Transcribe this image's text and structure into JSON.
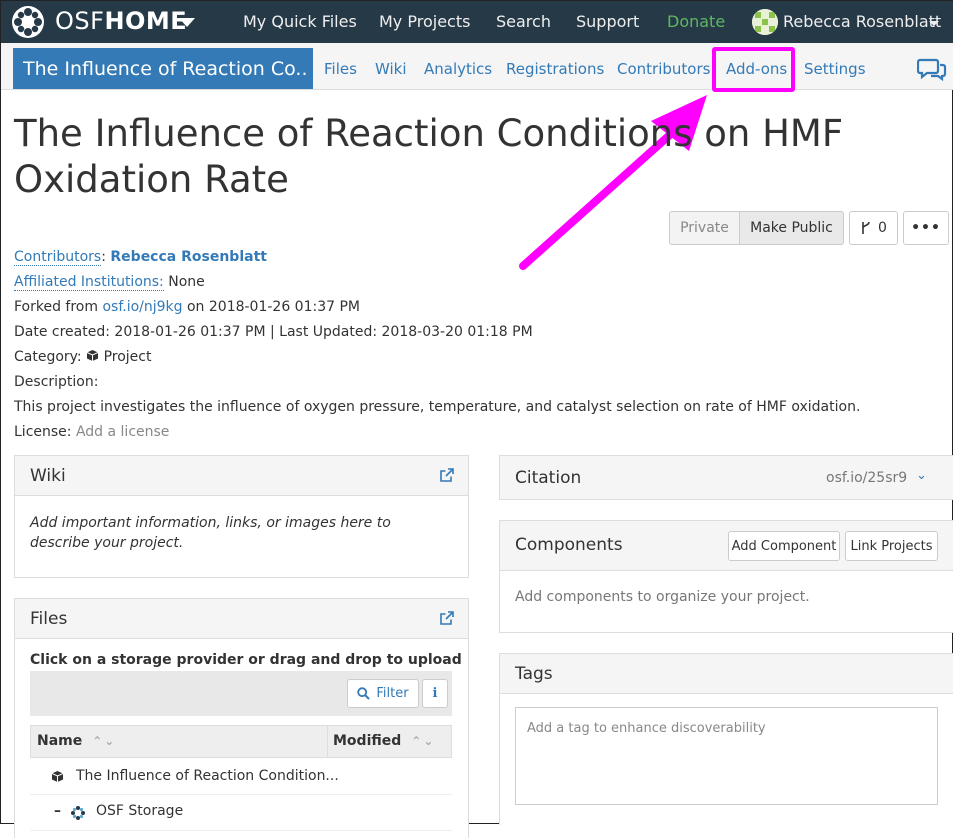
{
  "topnav": {
    "brand_light": "OSF",
    "brand_bold": "HOME",
    "items": [
      "My Quick Files",
      "My Projects",
      "Search",
      "Support",
      "Donate"
    ],
    "user_name": "Rebecca Rosenblatt"
  },
  "projnav": {
    "project_title": "The Influence of Reaction Co...",
    "tabs": [
      "Files",
      "Wiki",
      "Analytics",
      "Registrations",
      "Contributors",
      "Add-ons",
      "Settings"
    ]
  },
  "page": {
    "title": "The Influence of Reaction Conditions on HMF Oxidation Rate",
    "private_label": "Private",
    "make_public_label": "Make Public",
    "fork_count": "0",
    "more_label": "•••"
  },
  "meta": {
    "contributors_label": "Contributors",
    "contributors_value": "Rebecca Rosenblatt",
    "affiliated_label": "Affiliated Institutions:",
    "affiliated_value": "None",
    "forked_prefix": "Forked from",
    "forked_link": "osf.io/nj9kg",
    "forked_suffix": "on 2018-01-26 01:37 PM",
    "dates": "Date created: 2018-01-26 01:37 PM | Last Updated: 2018-03-20 01:18 PM",
    "category_label": "Category:",
    "category_value": "Project",
    "description_label": "Description:",
    "description": "This project investigates the influence of oxygen pressure, temperature, and catalyst selection on rate of HMF oxidation.",
    "license_label": "License:",
    "license_value": "Add a license"
  },
  "wiki": {
    "title": "Wiki",
    "placeholder": "Add important information, links, or images here to describe your project."
  },
  "files": {
    "title": "Files",
    "instruction": "Click on a storage provider or drag and drop to upload",
    "filter_label": "Filter",
    "info_label": "i",
    "col_name": "Name",
    "col_modified": "Modified",
    "rows": [
      "The Influence of Reaction Condition...",
      "OSF Storage"
    ]
  },
  "citation": {
    "title": "Citation",
    "link": "osf.io/25sr9"
  },
  "components": {
    "title": "Components",
    "add_label": "Add Component",
    "link_label": "Link Projects",
    "empty": "Add components to organize your project."
  },
  "tags": {
    "title": "Tags",
    "placeholder": "Add a tag to enhance discoverability"
  },
  "colors": {
    "navbar": "#263947",
    "accent": "#337ab7",
    "highlight": "#ff00ff",
    "donate": "#5fb85f"
  }
}
